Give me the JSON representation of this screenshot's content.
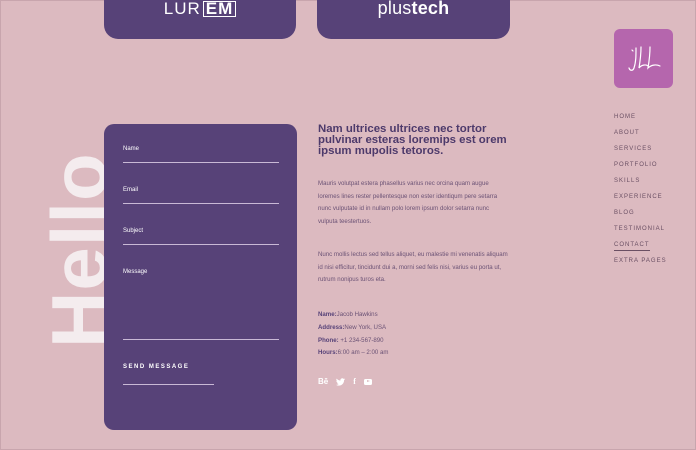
{
  "logos": {
    "lorem": {
      "text_a": "LUR",
      "text_b": "EM"
    },
    "plustech": {
      "text_a": "plus",
      "text_b": "tech"
    }
  },
  "brand": {
    "monogram": "JL"
  },
  "nav": {
    "items": [
      {
        "label": "HOME"
      },
      {
        "label": "ABOUT"
      },
      {
        "label": "SERVICES"
      },
      {
        "label": "PORTFOLIO"
      },
      {
        "label": "SKILLS"
      },
      {
        "label": "EXPERIENCE"
      },
      {
        "label": "BLOG"
      },
      {
        "label": "TESTIMONIAL"
      },
      {
        "label": "CONTACT",
        "active": true
      },
      {
        "label": "EXTRA PAGES"
      }
    ]
  },
  "hello": "Hello",
  "form": {
    "name_label": "Name",
    "email_label": "Email",
    "subject_label": "Subject",
    "message_label": "Message",
    "send_label": "SEND MESSAGE"
  },
  "content": {
    "heading": "Nam ultrices ultrices nec tortor pulvinar esteras loremips est orem ipsum mupolis tetoros.",
    "para1": "Mauris volutpat estera phasellus varius nec orcina quam augue loremes lines rester pellentesque non ester identiqum pere setarra nunc vulputate id in nullam polo lorem ipsum dolor setarra nunc vulputa teestertuos.",
    "para2": "Nunc mollis lectus sed tellus aliquet, eu malestie mi venenatis aliquam id nisi efficitur, tincidunt dui a, morni sed felis nisi, varius eu porta ut, rutrum nonipus turos eta.",
    "info": {
      "name_key": "Name:",
      "name_val": "Jacob Hawkins",
      "address_key": "Address:",
      "address_val": "New York, USA",
      "phone_key": "Phone:",
      "phone_val": " +1 234-567-890",
      "hours_key": "Hours:",
      "hours_val": "6:00 am – 2:00 am"
    },
    "social": {
      "behance": "Bē",
      "twitter": "🐦",
      "facebook": "f"
    }
  },
  "colors": {
    "background": "#dcbac0",
    "panel": "#574278",
    "brand": "#b566ad"
  }
}
